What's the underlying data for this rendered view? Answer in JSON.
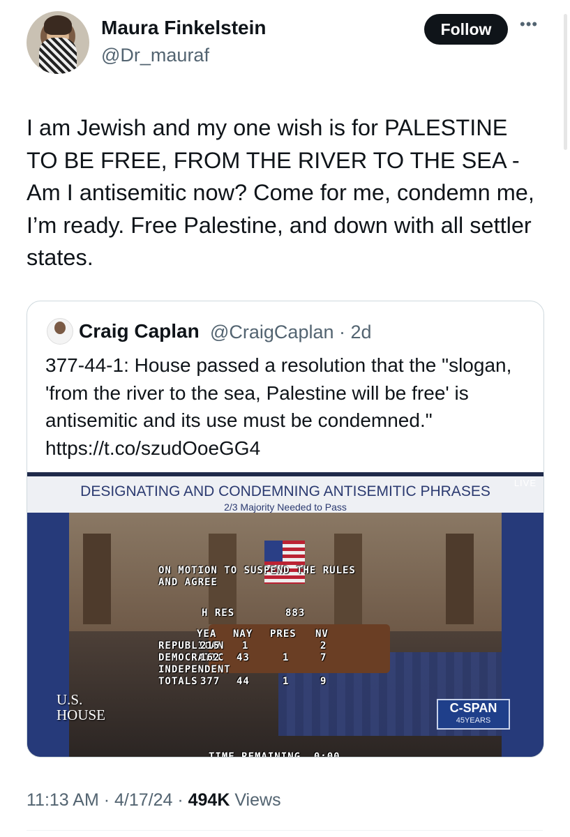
{
  "author": {
    "name": "Maura Finkelstein",
    "handle": "@Dr_mauraf"
  },
  "follow_label": "Follow",
  "more_label": "•••",
  "tweet_text": "I am Jewish and my one wish is for PALESTINE TO BE FREE, FROM THE RIVER TO THE SEA - Am I antisemitic now? Come for me, condemn me, I’m ready. Free Palestine, and down with all settler states.",
  "quote": {
    "name": "Craig Caplan",
    "handle_time": "@CraigCaplan · 2d",
    "text": "377-44-1: House passed a resolution that the \"slogan, 'from the river to the sea, Palestine will be free' is antisemitic and its use must be condemned.\" https://t.co/szudOoeGG4",
    "video": {
      "banner_title": "DESIGNATING AND CONDEMNING ANTISEMITIC PHRASES",
      "banner_subtitle": "2/3 Majority Needed to Pass",
      "live": "LIVE",
      "motion": "ON MOTION TO SUSPEND THE RULES AND AGREE",
      "hres_label": "H RES",
      "hres_number": "883",
      "table_headers": [
        "YEA",
        "NAY",
        "PRES",
        "NV"
      ],
      "rows": [
        {
          "party": "REPUBLICAN",
          "yea": "215",
          "nay": "1",
          "pres": "",
          "nv": "2"
        },
        {
          "party": "DEMOCRATIC",
          "yea": "162",
          "nay": "43",
          "pres": "1",
          "nv": "7"
        },
        {
          "party": "INDEPENDENT",
          "yea": "",
          "nay": "",
          "pres": "",
          "nv": ""
        },
        {
          "party": "TOTALS",
          "yea": "377",
          "nay": "44",
          "pres": "1",
          "nv": "9"
        }
      ],
      "time_remaining_label": "TIME REMAINING",
      "time_remaining_value": "0:00",
      "us_house_line1": "U.S.",
      "us_house_line2": "HOUSE",
      "cspan_name": "C-SPAN",
      "cspan_sub": "45YEARS"
    }
  },
  "meta": {
    "time": "11:13 AM · 4/17/24 · ",
    "views_count": "494K",
    "views_label": " Views"
  }
}
